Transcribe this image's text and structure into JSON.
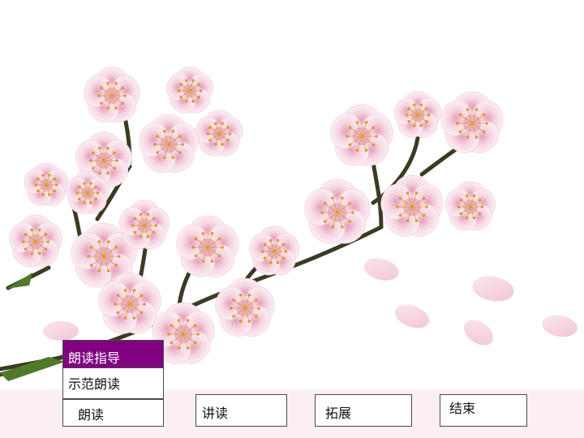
{
  "colors": {
    "menu_active_bg": "#800080",
    "bottom_bar_bg": "#fbeef4",
    "petal": "#f6dbe6",
    "petal_center": "#e9a9c2",
    "stamen": "#d99a2b",
    "branch": "#3c3a22",
    "leaf": "#4f7a2a"
  },
  "menu": {
    "items": [
      {
        "label": "朗读指导",
        "active": true
      },
      {
        "label": "示范朗读",
        "active": false
      }
    ]
  },
  "nav": {
    "buttons": [
      {
        "label": "朗读"
      },
      {
        "label": "讲读"
      },
      {
        "label": "拓展"
      },
      {
        "label": "结束"
      }
    ]
  }
}
